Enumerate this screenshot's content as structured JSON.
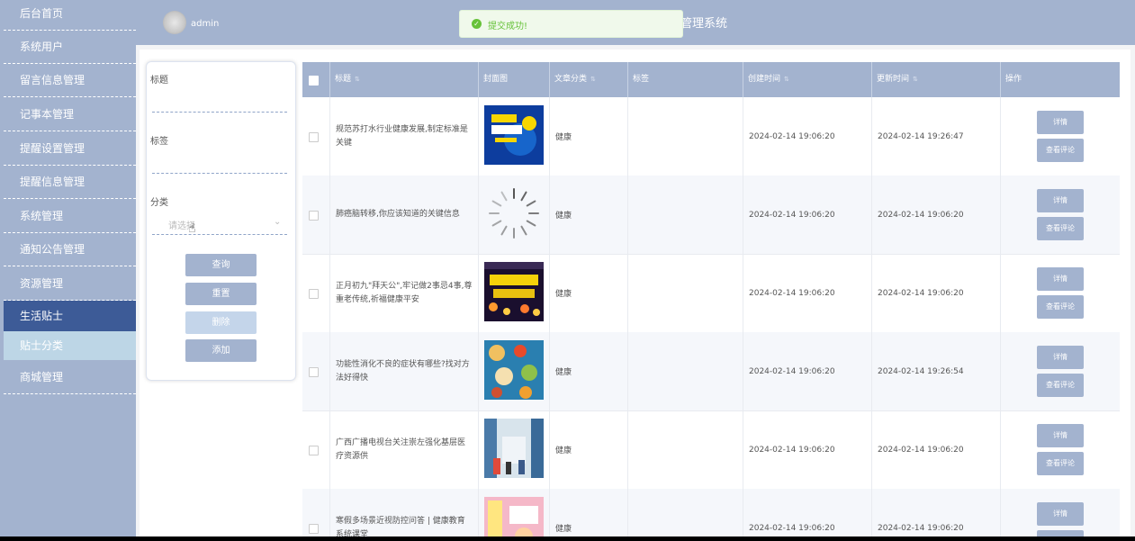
{
  "sidebar": {
    "items": [
      {
        "label": "后台首页",
        "state": "normal"
      },
      {
        "label": "系统用户",
        "state": "normal"
      },
      {
        "label": "留言信息管理",
        "state": "normal"
      },
      {
        "label": "记事本管理",
        "state": "normal"
      },
      {
        "label": "提醒设置管理",
        "state": "normal"
      },
      {
        "label": "提醒信息管理",
        "state": "normal"
      },
      {
        "label": "系统管理",
        "state": "normal"
      },
      {
        "label": "通知公告管理",
        "state": "normal"
      },
      {
        "label": "资源管理",
        "state": "normal"
      },
      {
        "label": "生活贴士",
        "state": "active"
      },
      {
        "label": "贴士分类",
        "state": "sub"
      },
      {
        "label": "商城管理",
        "state": "normal"
      }
    ]
  },
  "header": {
    "username": "admin",
    "title": "管理系统"
  },
  "toast": {
    "message": "提交成功!",
    "color": "#67c23a"
  },
  "filter": {
    "title_label": "标题",
    "tag_label": "标签",
    "category_label": "分类",
    "category_placeholder": "请选择",
    "search_button": "查询",
    "reset_button": "重置",
    "delete_button": "删除",
    "add_button": "添加"
  },
  "table": {
    "headers": {
      "title": "标题",
      "cover": "封面图",
      "category": "文章分类",
      "tag": "标签",
      "created": "创建时间",
      "updated": "更新时间",
      "actions": "操作"
    },
    "detail_button": "详情",
    "comments_button": "查看评论",
    "rows": [
      {
        "title": "规范苏打水行业健康发展,制定标准是关键",
        "category": "健康",
        "tag": "",
        "created": "2024-02-14 19:06:20",
        "updated": "2024-02-14 19:26:47",
        "cover": "image"
      },
      {
        "title": "肺癌脑转移,你应该知道的关键信息",
        "category": "健康",
        "tag": "",
        "created": "2024-02-14 19:06:20",
        "updated": "2024-02-14 19:06:20",
        "cover": "loading"
      },
      {
        "title": "正月初九\"拜天公\",牢记做2事忌4事,尊重老传统,祈福健康平安",
        "category": "健康",
        "tag": "",
        "created": "2024-02-14 19:06:20",
        "updated": "2024-02-14 19:06:20",
        "cover": "image"
      },
      {
        "title": "功能性消化不良的症状有哪些?找对方法好得快",
        "category": "健康",
        "tag": "",
        "created": "2024-02-14 19:06:20",
        "updated": "2024-02-14 19:26:54",
        "cover": "image"
      },
      {
        "title": "广西广播电视台关注崇左强化基层医疗资源供",
        "category": "健康",
        "tag": "",
        "created": "2024-02-14 19:06:20",
        "updated": "2024-02-14 19:06:20",
        "cover": "image"
      },
      {
        "title": "寒假多场景近视防控问答 | 健康教育系统课堂",
        "category": "健康",
        "tag": "",
        "created": "2024-02-14 19:06:20",
        "updated": "2024-02-14 19:06:20",
        "cover": "image"
      }
    ]
  },
  "colors": {
    "sidebar_bg": "#a3b3cf",
    "sidebar_active": "#3d5b97",
    "sidebar_sub": "#bdd6e6",
    "button": "#a3b3cf"
  }
}
